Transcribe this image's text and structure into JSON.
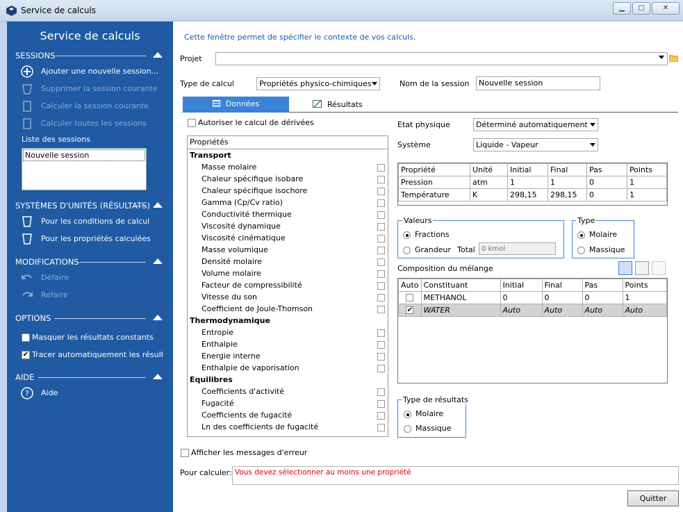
{
  "window": {
    "title": "Service de calculs"
  },
  "sidebar": {
    "title": "Service de calculs",
    "sessions": {
      "header": "SESSIONS",
      "items": [
        "Ajouter une nouvelle session...",
        "Supprimer la session courante",
        "Calculer la session courante",
        "Calculer toutes les sessions"
      ],
      "list_label": "Liste des sessions",
      "list": [
        "Nouvelle session"
      ]
    },
    "units": {
      "header": "SYSTÈMES D'UNITÉS (RÉSULTATS)",
      "items": [
        "Pour les conditions de calcul",
        "Pour les propriétés calculées"
      ]
    },
    "modifications": {
      "header": "MODIFICATIONS",
      "items": [
        "Défaire",
        "Refaire"
      ]
    },
    "options": {
      "header": "OPTIONS",
      "items": [
        {
          "label": "Masquer les résultats constants",
          "checked": false
        },
        {
          "label": "Tracer automatiquement les résultats",
          "checked": true
        }
      ]
    },
    "help": {
      "header": "AIDE",
      "items": [
        "Aide"
      ]
    }
  },
  "main": {
    "intro": "Cette fenêtre permet de spécifier le contexte de vos calculs.",
    "projet_label": "Projet",
    "projet_value": "",
    "type_label": "Type de calcul",
    "type_value": "Propriétés physico-chimiques",
    "nom_label": "Nom de la session",
    "nom_value": "Nouvelle session",
    "tabs": [
      "Données",
      "Résultats"
    ],
    "derivees_label": "Autoriser le calcul de dérivées",
    "props_header": "Propriétés",
    "groups": [
      {
        "name": "Transport",
        "props": [
          "Masse molaire",
          "Chaleur spécifique isobare",
          "Chaleur spécifique isochore",
          "Gamma (Cp/Cv ratio)",
          "Conductivité thermique",
          "Viscosité dynamique",
          "Viscosité cinématique",
          "Masse volumique",
          "Densité molaire",
          "Volume molaire",
          "Facteur de compressibilité",
          "Vitesse du son",
          "Coefficient de Joule-Thomson"
        ]
      },
      {
        "name": "Thermodynamique",
        "props": [
          "Entropie",
          "Enthalpie",
          "Energie interne",
          "Enthalpie de vaporisation"
        ]
      },
      {
        "name": "Equilibres",
        "props": [
          "Coefficients d'activité",
          "Fugacité",
          "Coefficients de fugacité",
          "Ln des coefficients de fugacité"
        ]
      }
    ],
    "etat_label": "Etat physique",
    "etat_value": "Déterminé automatiquement",
    "systeme_label": "Système",
    "systeme_value": "Liquide - Vapeur",
    "cond_headers": [
      "Propriété",
      "Unité",
      "Initial",
      "Final",
      "Pas",
      "Points"
    ],
    "cond_rows": [
      [
        "Pression",
        "atm",
        "1",
        "1",
        "0",
        "1"
      ],
      [
        "Température",
        "K",
        "298,15",
        "298,15",
        "0",
        "1"
      ]
    ],
    "valeurs": {
      "title": "Valeurs",
      "fractions": "Fractions",
      "grandeur": "Grandeur",
      "total_label": "Total",
      "total_placeholder": "0 kmol"
    },
    "type_group": {
      "title": "Type",
      "molaire": "Molaire",
      "massique": "Massique"
    },
    "composition_label": "Composition du mélange",
    "comp_headers": [
      "Auto",
      "Constituant",
      "Initial",
      "Final",
      "Pas",
      "Points"
    ],
    "comp_rows": [
      {
        "auto": false,
        "cells": [
          "METHANOL",
          "0",
          "0",
          "0",
          "1"
        ]
      },
      {
        "auto": true,
        "cells": [
          "WATER",
          "Auto",
          "Auto",
          "Auto",
          "Auto"
        ]
      }
    ],
    "type_resultats": {
      "title": "Type de résultats",
      "molaire": "Molaire",
      "massique": "Massique"
    },
    "erreurs_label": "Afficher les messages d'erreur",
    "calculer_label": "Pour calculer:",
    "calculer_msg": "Vous devez sélectionner au moins une propriété",
    "quit_label": "Quitter"
  }
}
